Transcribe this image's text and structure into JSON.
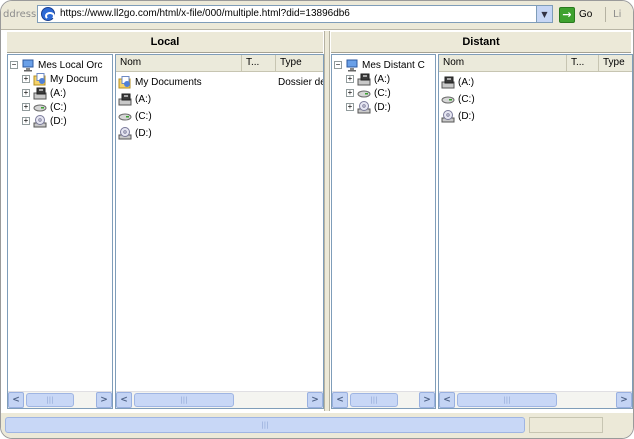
{
  "address_bar": {
    "label": "ddress",
    "url": "https://www.ll2go.com/html/x-file/000/multiple.html?did=13896db6",
    "go_label": "Go",
    "links_label": "Li"
  },
  "local": {
    "header": "Local",
    "tree": {
      "root": "Mes  Local Orc",
      "items": [
        "My Docum",
        "(A:)",
        "(C:)",
        "(D:)"
      ]
    },
    "columns": [
      "Nom",
      "T...",
      "Type"
    ],
    "rows": [
      {
        "name": "My Documents",
        "type": "Dossier de"
      },
      {
        "name": "(A:)",
        "type": ""
      },
      {
        "name": "(C:)",
        "type": ""
      },
      {
        "name": "(D:)",
        "type": ""
      }
    ]
  },
  "distant": {
    "header": "Distant",
    "tree": {
      "root": "Mes Distant C",
      "items": [
        "(A:)",
        "(C:)",
        "(D:)"
      ]
    },
    "columns": [
      "Nom",
      "T...",
      "Type"
    ],
    "rows": [
      {
        "name": "(A:)"
      },
      {
        "name": "(C:)"
      },
      {
        "name": "(D:)"
      }
    ]
  },
  "icons": {
    "computer": "computer-icon",
    "documents": "my-documents-icon",
    "floppy": "floppy-drive-icon",
    "harddisk": "hard-drive-icon",
    "cdrom": "cd-drive-icon"
  },
  "colors": {
    "chrome": "#ece9d8",
    "border": "#7f9db9",
    "scroll": "#c4d4f4"
  }
}
